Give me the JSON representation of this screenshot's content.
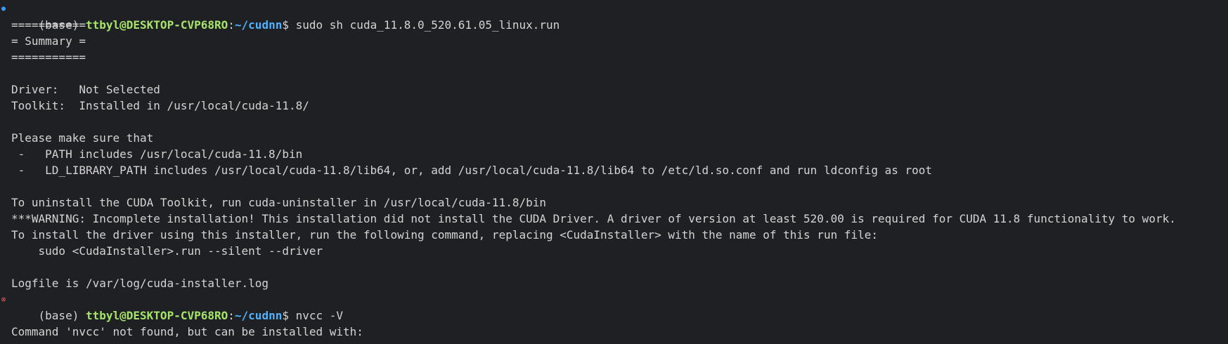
{
  "terminal": {
    "prompt1": {
      "env": "(base) ",
      "user": "ttbyl@DESKTOP-CVP68RO",
      "colon": ":",
      "path": "~/cudnn",
      "dollar": "$ ",
      "command": "sudo sh cuda_11.8.0_520.61.05_linux.run"
    },
    "output1": [
      "===========",
      "= Summary =",
      "===========",
      "",
      "Driver:   Not Selected",
      "Toolkit:  Installed in /usr/local/cuda-11.8/",
      "",
      "Please make sure that",
      " -   PATH includes /usr/local/cuda-11.8/bin",
      " -   LD_LIBRARY_PATH includes /usr/local/cuda-11.8/lib64, or, add /usr/local/cuda-11.8/lib64 to /etc/ld.so.conf and run ldconfig as root",
      "",
      "To uninstall the CUDA Toolkit, run cuda-uninstaller in /usr/local/cuda-11.8/bin",
      "***WARNING: Incomplete installation! This installation did not install the CUDA Driver. A driver of version at least 520.00 is required for CUDA 11.8 functionality to work.",
      "To install the driver using this installer, run the following command, replacing <CudaInstaller> with the name of this run file:",
      "    sudo <CudaInstaller>.run --silent --driver",
      "",
      "Logfile is /var/log/cuda-installer.log"
    ],
    "prompt2": {
      "env": "(base) ",
      "user": "ttbyl@DESKTOP-CVP68RO",
      "colon": ":",
      "path": "~/cudnn",
      "dollar": "$ ",
      "command": "nvcc -V"
    },
    "output2": [
      "",
      "Command 'nvcc' not found, but can be installed with:"
    ],
    "markers": {
      "success": "●",
      "error": "⊗"
    }
  }
}
